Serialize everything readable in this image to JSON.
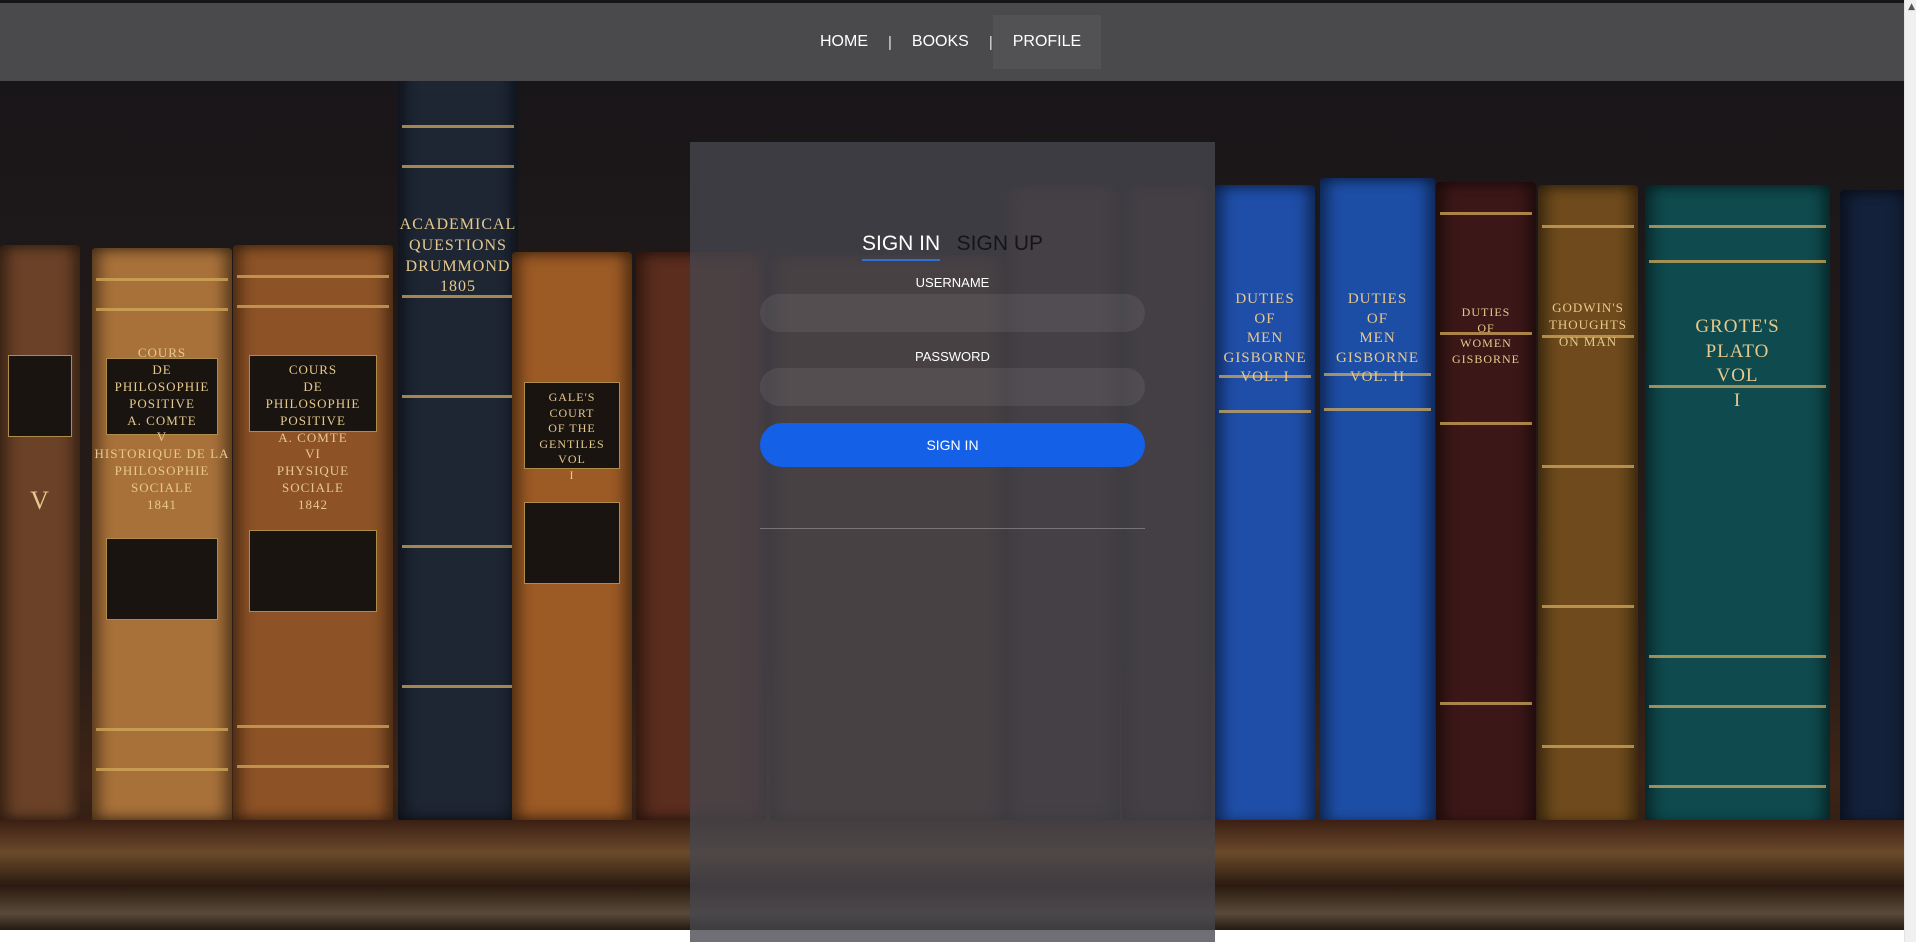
{
  "nav": {
    "home": "HOME",
    "separator": "|",
    "books": "BOOKS",
    "profile": "PROFILE"
  },
  "auth": {
    "tab_signin": "SIGN IN",
    "tab_signup": "SIGN UP",
    "username_label": "USERNAME",
    "username_value": "",
    "password_label": "PASSWORD",
    "password_value": "",
    "submit_label": "SIGN IN"
  },
  "background": {
    "books": [
      {
        "lines": [
          "COURS",
          "DE",
          "PHILOSOPHIE",
          "POSITIVE",
          "A. COMTE",
          "V",
          "HISTORIQUE DE LA",
          "PHILOSOPHIE",
          "SOCIALE",
          "1841"
        ]
      },
      {
        "lines": [
          "COURS",
          "DE",
          "PHILOSOPHIE",
          "POSITIVE",
          "A. COMTE",
          "VI",
          "PHYSIQUE",
          "SOCIALE",
          "1842"
        ]
      },
      {
        "lines": [
          "ACADEMICAL",
          "QUESTIONS",
          "DRUMMOND",
          "1805"
        ]
      },
      {
        "lines": [
          "GALE'S",
          "COURT",
          "OF THE",
          "GENTILES",
          "VOL",
          "I"
        ]
      },
      {
        "lines": [
          "DUTIES",
          "OF",
          "MEN",
          "GISBORNE",
          "VOL. I"
        ]
      },
      {
        "lines": [
          "DUTIES",
          "OF",
          "MEN",
          "GISBORNE",
          "VOL. II"
        ]
      },
      {
        "lines": [
          "DUTIES",
          "OF",
          "WOMEN",
          "GISBORNE"
        ]
      },
      {
        "lines": [
          "GODWIN'S",
          "THOUGHTS",
          "ON MAN"
        ]
      },
      {
        "lines": [
          "GROTE'S",
          "PLATO",
          "VOL",
          "I"
        ]
      }
    ]
  }
}
